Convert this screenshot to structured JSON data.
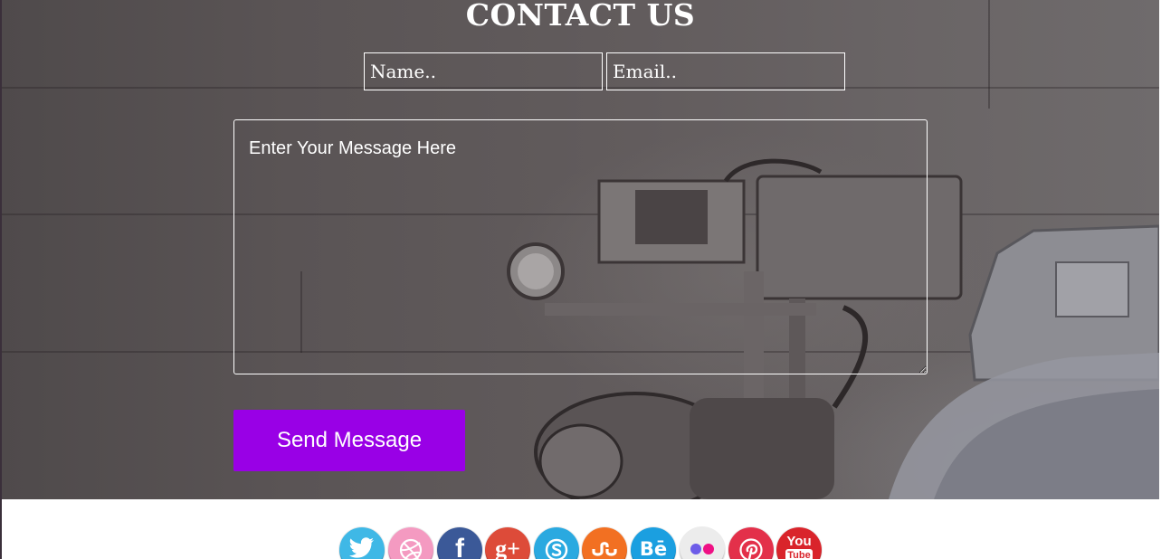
{
  "contact": {
    "title": "CONTACT US",
    "name_placeholder": "Name..",
    "email_placeholder": "Email..",
    "message_placeholder": "Enter Your Message Here",
    "send_label": "Send Message",
    "accent_color": "#9900e6"
  },
  "social": {
    "items": [
      {
        "name": "twitter",
        "icon": "twitter-icon",
        "color": "#3fb8e6"
      },
      {
        "name": "dribbble",
        "icon": "dribbble-icon",
        "color": "#f49ac1"
      },
      {
        "name": "facebook",
        "icon": "facebook-icon",
        "color": "#3b5998"
      },
      {
        "name": "google-plus",
        "icon": "google-plus-icon",
        "color": "#dd4b39"
      },
      {
        "name": "skype",
        "icon": "skype-icon",
        "color": "#2aa9e0"
      },
      {
        "name": "stumbleupon",
        "icon": "stumbleupon-icon",
        "color": "#f27022"
      },
      {
        "name": "behance",
        "icon": "behance-icon",
        "color": "#1b9fe0"
      },
      {
        "name": "flickr",
        "icon": "flickr-icon",
        "color": "#ececec"
      },
      {
        "name": "pinterest",
        "icon": "pinterest-icon",
        "color": "#e3304a"
      },
      {
        "name": "youtube",
        "icon": "youtube-icon",
        "color": "#d9242b"
      }
    ],
    "glyphs": {
      "facebook": "f",
      "google_plus": "g+",
      "behance": "Bē",
      "youtube_top": "You",
      "youtube_bottom": "Tube"
    }
  }
}
